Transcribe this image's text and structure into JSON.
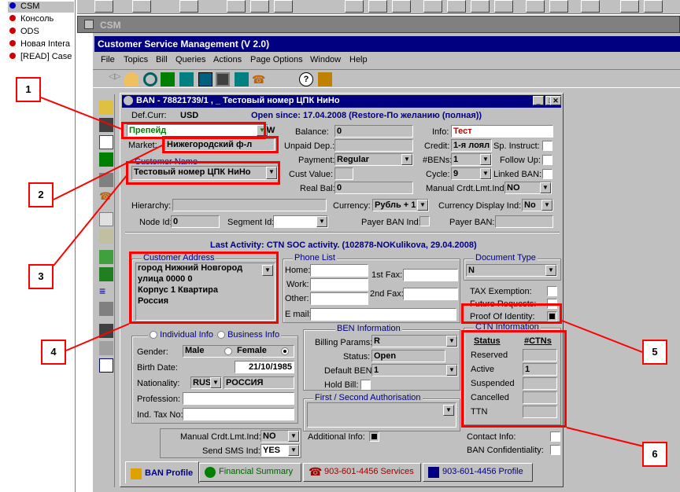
{
  "left_list": {
    "items": [
      {
        "label": "CSM",
        "color": "#0000c0"
      },
      {
        "label": "Консоль",
        "color": "#d00000"
      },
      {
        "label": "ODS",
        "color": "#d00000"
      },
      {
        "label": "Новая Intera",
        "color": "#d00000"
      },
      {
        "label": "[READ] Case",
        "color": "#d00000"
      }
    ]
  },
  "csm_window": {
    "title": "CSM"
  },
  "app": {
    "title": "Customer Service Management  (V 2.0)",
    "menu": [
      "File",
      "Topics",
      "Bill",
      "Queries",
      "Actions",
      "Page Options",
      "Window",
      "Help"
    ]
  },
  "ban": {
    "title": "BAN - 78821739/1 , _ Тестовый номер ЦПК НиНо",
    "def_curr_label": "Def.Curr:",
    "def_curr": "USD",
    "open_since": "Open since: 17.04.2008 (Restore-По желанию (полная))",
    "account_type": "Препейд",
    "w": "W",
    "market_label": "Market:",
    "market": "Нижегородский ф-л",
    "customer_name_label": "Customer Name",
    "customer_name": "Тестовый номер ЦПК НиНо",
    "balance_label": "Balance:",
    "balance": "0",
    "unpaid_label": "Unpaid Dep.:",
    "unpaid": "",
    "payment_label": "Payment:",
    "payment": "Regular",
    "cust_value_label": "Cust Value:",
    "cust_value": "",
    "real_bal_label": "Real Bal:",
    "real_bal": "0",
    "info_label": "Info:",
    "info": "Тест",
    "credit_label": "Credit:",
    "credit": "1-я лоял",
    "bens_label": "#BENs:",
    "bens": "1",
    "cycle_label": "Cycle:",
    "cycle": "9",
    "manual_label": "Manual Crdt.Lmt.Ind:",
    "manual": "NO",
    "sp_instruct_label": "Sp. Instruct:",
    "follow_up_label": "Follow Up:",
    "linked_ban_label": "Linked BAN:",
    "hierarchy_label": "Hierarchy:",
    "hierarchy": "",
    "currency_label": "Currency:",
    "currency": "Рубль + 1",
    "currency_disp_label": "Currency Display Ind:",
    "currency_disp": "No",
    "node_id_label": "Node Id:",
    "node_id": "0",
    "segment_id_label": "Segment Id:",
    "segment_id": "",
    "payer_ban_ind_label": "Payer BAN Ind:",
    "payer_ban_label": "Payer BAN:",
    "payer_ban": "",
    "last_activity": "Last Activity: CTN SOC activity. (102878-NOKulikova, 29.04.2008)",
    "address": {
      "title": "Customer Address",
      "lines": [
        "город Нижний Новгород",
        "улица 0000  0",
        "Корпус 1 Квартира",
        "Россия"
      ]
    },
    "phone": {
      "title": "Phone List",
      "home": "Home:",
      "work": "Work:",
      "other": "Other:",
      "email": "E mail:",
      "fax1": "1st Fax:",
      "fax2": "2nd Fax:"
    },
    "doctype": {
      "title": "Document Type",
      "value": "N"
    },
    "tax_exemption": "TAX Exemption:",
    "future_requests": "Future Requests:",
    "proof": "Proof Of Identity:",
    "ctn": {
      "title": "CTN Information",
      "status_h": "Status",
      "ctns_h": "#CTNs",
      "rows": [
        {
          "label": "Reserved",
          "value": ""
        },
        {
          "label": "Active",
          "value": "1"
        },
        {
          "label": "Suspended",
          "value": ""
        },
        {
          "label": "Cancelled",
          "value": ""
        },
        {
          "label": "TTN",
          "value": ""
        }
      ]
    },
    "individual": {
      "indiv_label": "Individual Info",
      "business_label": "Business Info",
      "gender_label": "Gender:",
      "male": "Male",
      "female": "Female",
      "birth_label": "Birth Date:",
      "birth": "21/10/1985",
      "nationality_label": "Nationality:",
      "nat_code": "RUS",
      "nat_name": "РОССИЯ",
      "profession_label": "Profession:",
      "tax_label": "Ind. Tax No:"
    },
    "ben": {
      "title": "BEN Information",
      "billing_label": "Billing Params:",
      "billing": "R",
      "status_label": "Status:",
      "status": "Open",
      "default_label": "Default BEN:",
      "default": "1",
      "hold_label": "Hold Bill:",
      "auth_title": "First / Second  Authorisation"
    },
    "manual2_label": "Manual Crdt.Lmt.Ind:",
    "manual2": "NO",
    "sms_label": "Send SMS Ind:",
    "sms": "YES",
    "additional_label": "Additional Info:",
    "contact_label": "Contact Info:",
    "conf_label": "BAN Confidentiality:",
    "tabs": [
      "BAN Profile",
      "Financial Summary",
      "903-601-4456 Services",
      "903-601-4456 Profile"
    ]
  },
  "callouts": [
    "1",
    "2",
    "3",
    "4",
    "5",
    "6"
  ]
}
